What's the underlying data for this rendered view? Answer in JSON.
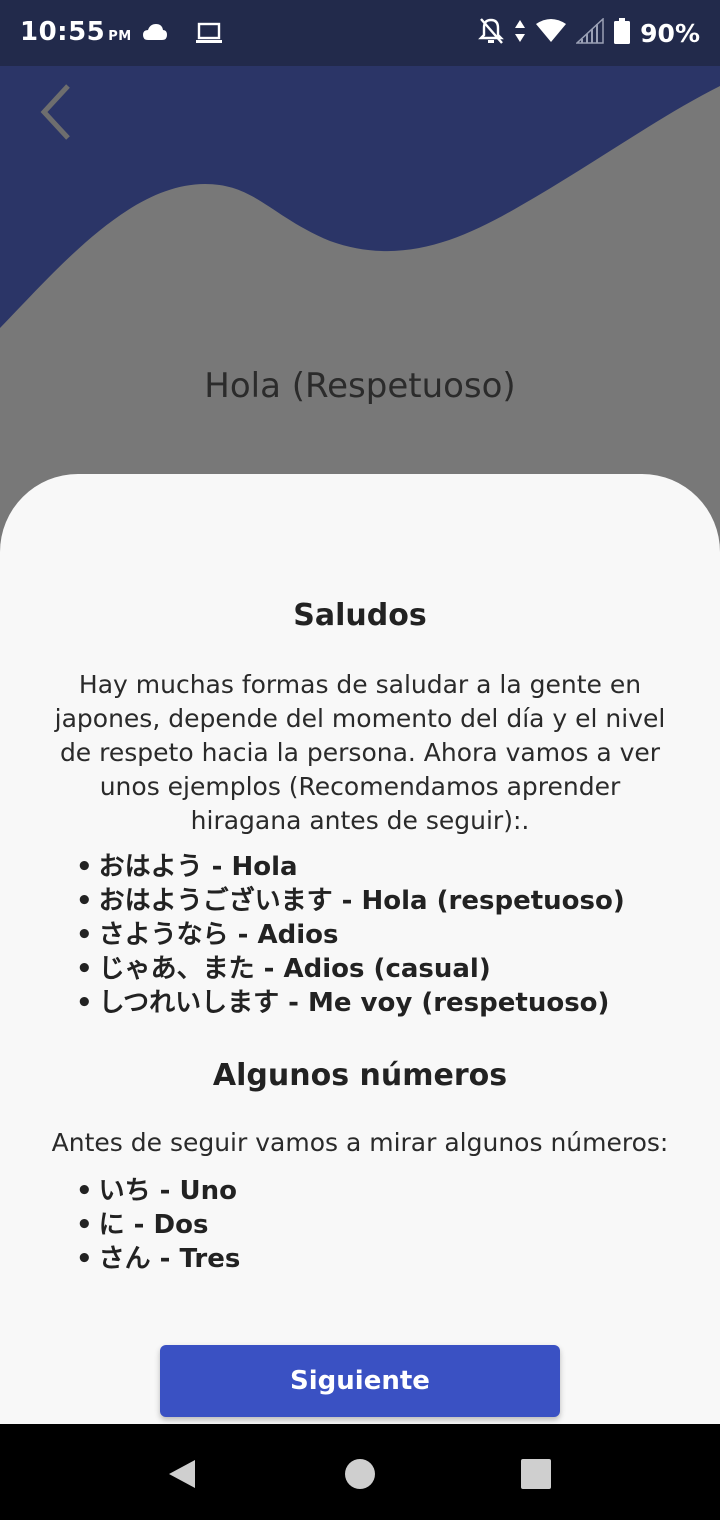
{
  "status_bar": {
    "time": "10:55",
    "ampm": "PM",
    "battery": "90%"
  },
  "header": {
    "title": "Hola (Respetuoso)"
  },
  "greetings": {
    "heading": "Saludos",
    "intro": "Hay muchas formas de saludar a la gente en japones, depende del momento del día y el nivel de respeto hacia la persona. Ahora vamos a ver unos ejemplos (Recomendamos aprender hiragana antes de seguir):.",
    "items": [
      "おはよう - Hola",
      "おはようございます - Hola (respetuoso)",
      "さようなら - Adios",
      "じゃあ、また - Adios (casual)",
      "しつれいします - Me voy (respetuoso)"
    ]
  },
  "numbers": {
    "heading": "Algunos números",
    "intro": "Antes de seguir vamos a mirar algunos números:",
    "items": [
      "いち - Uno",
      "に - Dos",
      "さん - Tres"
    ]
  },
  "next_button": {
    "label": "Siguiente"
  },
  "colors": {
    "status_bar": "#222a4b",
    "wave": "#2b3567",
    "background": "#787878",
    "card": "#f8f8f8",
    "button": "#3a51c3"
  }
}
